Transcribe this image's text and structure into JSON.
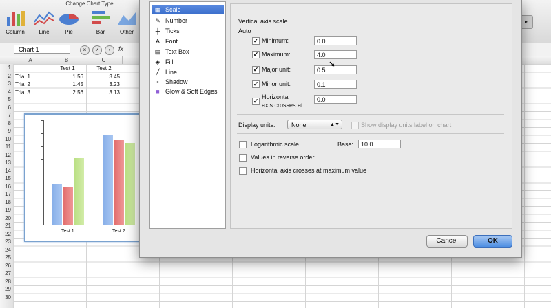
{
  "ribbon": {
    "group_label": "Change Chart Type",
    "chart_types": [
      {
        "label": "Column",
        "icon": "column-chart-icon"
      },
      {
        "label": "Line",
        "icon": "line-chart-icon"
      },
      {
        "label": "Pie",
        "icon": "pie-chart-icon"
      },
      {
        "label": "Bar",
        "icon": "bar-chart-icon"
      },
      {
        "label": "Other",
        "icon": "other-chart-icon"
      }
    ]
  },
  "formula_bar": {
    "name_box": "Chart 1",
    "fx": "fx"
  },
  "sheet": {
    "columns": [
      "A",
      "B",
      "C"
    ],
    "rows": [
      "1",
      "2",
      "3",
      "4",
      "5",
      "6",
      "7",
      "8",
      "9",
      "10",
      "11",
      "12",
      "13",
      "14",
      "15",
      "16",
      "17",
      "18",
      "19",
      "20",
      "21",
      "22",
      "23",
      "24",
      "25",
      "26",
      "27",
      "28",
      "29",
      "30"
    ],
    "headers": [
      "Test 1",
      "Test 2"
    ],
    "data": [
      {
        "label": "Trial 1",
        "test1": "1.56",
        "test2": "3.45"
      },
      {
        "label": "Trial 2",
        "test1": "1.45",
        "test2": "3.23"
      },
      {
        "label": "Trial 3",
        "test1": "2.56",
        "test2": "3.13"
      }
    ]
  },
  "embedded_chart": {
    "categories": [
      "Test 1",
      "Test 2"
    ],
    "series": [
      {
        "values": [
          1.56,
          3.45
        ],
        "color": "#8fb4ea"
      },
      {
        "values": [
          1.45,
          3.23
        ],
        "color": "#e57a7a"
      },
      {
        "values": [
          2.56,
          3.13
        ],
        "color": "#c0e28e"
      }
    ],
    "ylim": [
      0,
      4
    ]
  },
  "dialog": {
    "categories": [
      {
        "label": "Scale",
        "icon": "scale-icon",
        "selected": true
      },
      {
        "label": "Number",
        "icon": "number-icon"
      },
      {
        "label": "Ticks",
        "icon": "ticks-icon"
      },
      {
        "label": "Font",
        "icon": "font-icon"
      },
      {
        "label": "Text Box",
        "icon": "text-box-icon"
      },
      {
        "label": "Fill",
        "icon": "fill-icon"
      },
      {
        "label": "Line",
        "icon": "line-icon"
      },
      {
        "label": "Shadow",
        "icon": "shadow-icon"
      },
      {
        "label": "Glow & Soft Edges",
        "icon": "glow-icon"
      }
    ],
    "scale": {
      "section_title": "Vertical axis scale",
      "auto_label": "Auto",
      "minimum": {
        "label": "Minimum:",
        "value": "0.0",
        "auto": true
      },
      "maximum": {
        "label": "Maximum:",
        "value": "4.0",
        "auto": true
      },
      "major_unit": {
        "label": "Major unit:",
        "value": "0.5",
        "auto": true
      },
      "minor_unit": {
        "label": "Minor unit:",
        "value": "0.1",
        "auto": true
      },
      "crosses": {
        "label_line1": "Horizontal",
        "label_line2": "axis crosses at:",
        "value": "0.0",
        "auto": true
      },
      "display_units_label": "Display units:",
      "display_units_value": "None",
      "show_units_label": "Show display units label on chart",
      "log_scale_label": "Logarithmic scale",
      "base_label": "Base:",
      "base_value": "10.0",
      "reverse_label": "Values in reverse order",
      "max_cross_label": "Horizontal axis crosses at maximum value"
    },
    "cancel_label": "Cancel",
    "ok_label": "OK"
  }
}
